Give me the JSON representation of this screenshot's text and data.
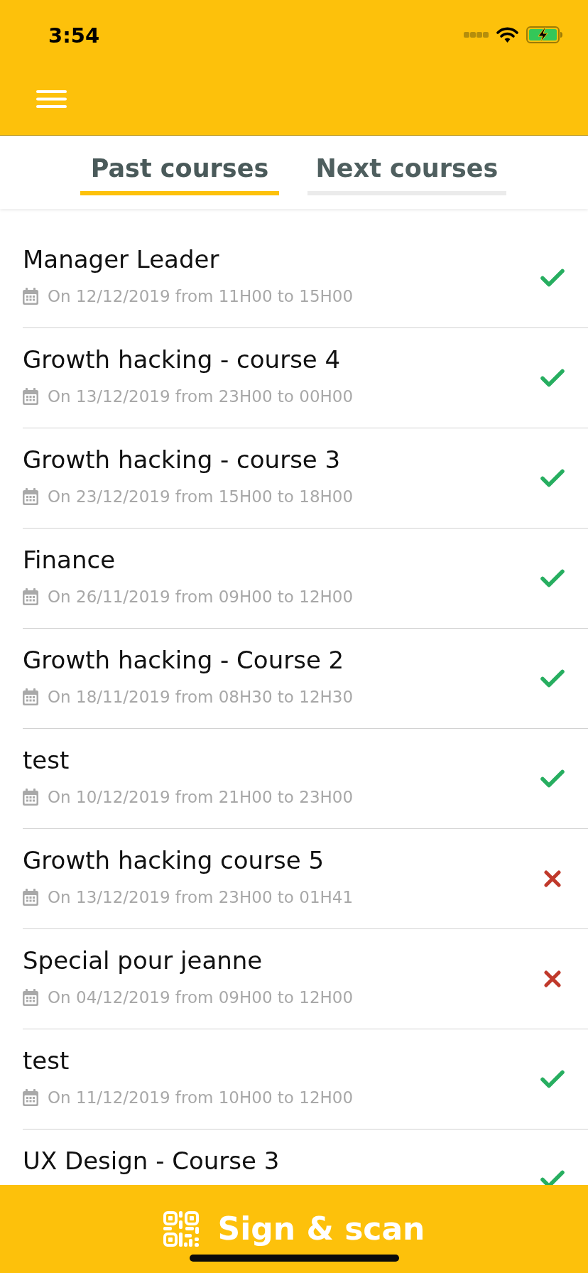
{
  "status_bar": {
    "time": "3:54"
  },
  "tabs": [
    {
      "label": "Past courses",
      "selected": true
    },
    {
      "label": "Next courses",
      "selected": false
    }
  ],
  "courses": [
    {
      "title": "Manager Leader",
      "schedule": "On 12/12/2019 from 11H00 to 15H00",
      "attended": true
    },
    {
      "title": "Growth hacking - course 4",
      "schedule": "On 13/12/2019 from 23H00 to 00H00",
      "attended": true
    },
    {
      "title": "Growth hacking - course 3",
      "schedule": "On 23/12/2019 from 15H00 to 18H00",
      "attended": true
    },
    {
      "title": "Finance",
      "schedule": "On 26/11/2019 from 09H00 to 12H00",
      "attended": true
    },
    {
      "title": "Growth hacking - Course 2",
      "schedule": "On 18/11/2019 from 08H30 to 12H30",
      "attended": true
    },
    {
      "title": "test",
      "schedule": "On 10/12/2019 from 21H00 to 23H00",
      "attended": true
    },
    {
      "title": "Growth hacking course 5",
      "schedule": "On 13/12/2019 from 23H00 to 01H41",
      "attended": false
    },
    {
      "title": "Special pour jeanne",
      "schedule": "On 04/12/2019 from 09H00 to 12H00",
      "attended": false
    },
    {
      "title": "test",
      "schedule": "On 11/12/2019 from 10H00 to 12H00",
      "attended": true
    },
    {
      "title": "UX Design - Course 3",
      "attended": true
    }
  ],
  "action_bar": {
    "label": "Sign & scan"
  }
}
